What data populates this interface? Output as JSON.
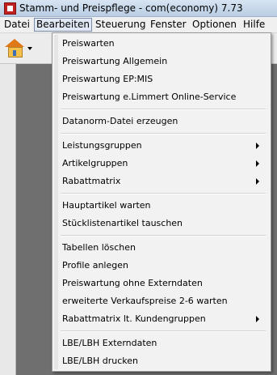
{
  "window": {
    "title": "Stamm- und Preispflege - com(economy) 7.73"
  },
  "menubar": [
    "Datei",
    "Bearbeiten",
    "Steuerung",
    "Fenster",
    "Optionen",
    "Hilfe"
  ],
  "menu": {
    "group1": [
      "Preiswarten",
      "Preiswartung Allgemein",
      "Preiswartung EP:MIS",
      "Preiswartung e.Limmert Online-Service"
    ],
    "group2": [
      "Datanorm-Datei erzeugen"
    ],
    "group3": [
      "Leistungsgruppen",
      "Artikelgruppen",
      "Rabattmatrix"
    ],
    "group4": [
      "Hauptartikel warten",
      "Stücklistenartikel tauschen"
    ],
    "group5": [
      "Tabellen löschen",
      "Profile anlegen",
      "Preiswartung ohne Externdaten",
      "erweiterte Verkaufspreise 2-6 warten",
      "Rabattmatrix lt. Kundengruppen"
    ],
    "group6": [
      "LBE/LBH Externdaten",
      "LBE/LBH drucken"
    ]
  }
}
